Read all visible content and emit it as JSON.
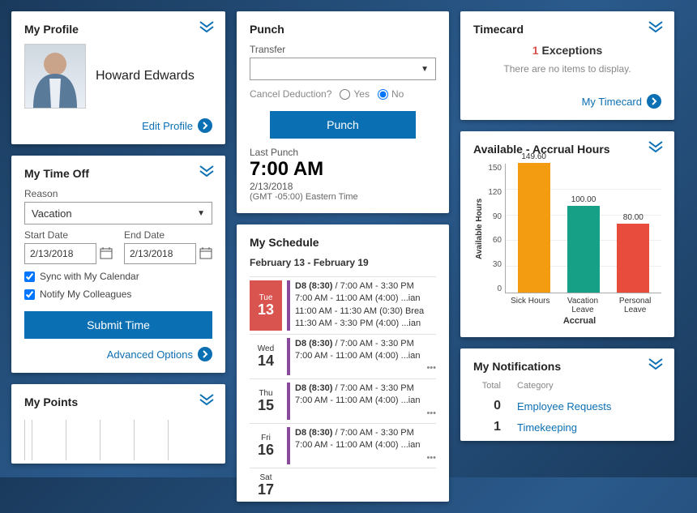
{
  "profile": {
    "title": "My Profile",
    "name": "Howard Edwards",
    "edit_link": "Edit Profile"
  },
  "timeoff": {
    "title": "My Time Off",
    "reason_label": "Reason",
    "reason_value": "Vacation",
    "start_label": "Start Date",
    "start_value": "2/13/2018",
    "end_label": "End Date",
    "end_value": "2/13/2018",
    "sync_label": "Sync with My Calendar",
    "notify_label": "Notify My Colleagues",
    "submit_label": "Submit Time",
    "advanced_label": "Advanced Options"
  },
  "points": {
    "title": "My Points"
  },
  "punch": {
    "title": "Punch",
    "transfer_label": "Transfer",
    "transfer_value": "",
    "cancel_label": "Cancel Deduction?",
    "yes": "Yes",
    "no": "No",
    "button": "Punch",
    "last_label": "Last Punch",
    "last_time": "7:00 AM",
    "last_date": "2/13/2018",
    "tz": "(GMT -05:00) Eastern Time"
  },
  "schedule": {
    "title": "My Schedule",
    "range": "February 13 - February 19",
    "days": [
      {
        "dow": "Tue",
        "num": "13",
        "active": true,
        "lines": [
          "D8 (8:30) / 7:00 AM - 3:30 PM",
          "7:00 AM - 11:00 AM (4:00)   ...ian",
          "11:00 AM - 11:30 AM (0:30)  Brea",
          "11:30 AM -  3:30 PM (4:00)  ...ian"
        ]
      },
      {
        "dow": "Wed",
        "num": "14",
        "active": false,
        "lines": [
          "D8 (8:30) / 7:00 AM - 3:30 PM",
          "7:00 AM - 11:00 AM (4:00)   ...ian"
        ]
      },
      {
        "dow": "Thu",
        "num": "15",
        "active": false,
        "lines": [
          "D8 (8:30) / 7:00 AM - 3:30 PM",
          "7:00 AM - 11:00 AM (4:00)   ...ian"
        ]
      },
      {
        "dow": "Fri",
        "num": "16",
        "active": false,
        "lines": [
          "D8 (8:30) / 7:00 AM - 3:30 PM",
          "7:00 AM - 11:00 AM (4:00)   ...ian"
        ]
      },
      {
        "dow": "Sat",
        "num": "17",
        "active": false,
        "lines": []
      }
    ]
  },
  "timecard": {
    "title": "Timecard",
    "exc_count": "1",
    "exc_label": "Exceptions",
    "empty": "There are no items to display.",
    "link": "My Timecard"
  },
  "accrual": {
    "title": "Available - Accrual Hours",
    "ylabel": "Available Hours",
    "xlabel": "Accrual"
  },
  "chart_data": {
    "type": "bar",
    "title": "Available - Accrual Hours",
    "ylabel": "Available Hours",
    "xlabel": "Accrual",
    "ylim": [
      0,
      150
    ],
    "yticks": [
      150,
      120,
      90,
      60,
      30,
      0
    ],
    "categories": [
      "Sick Hours",
      "Vacation Leave",
      "Personal Leave"
    ],
    "values": [
      149.6,
      100.0,
      80.0
    ],
    "colors": [
      "#f39c12",
      "#16a085",
      "#e74c3c"
    ]
  },
  "notifications": {
    "title": "My Notifications",
    "h_total": "Total",
    "h_cat": "Category",
    "rows": [
      {
        "n": "0",
        "cat": "Employee Requests"
      },
      {
        "n": "1",
        "cat": "Timekeeping"
      }
    ]
  }
}
